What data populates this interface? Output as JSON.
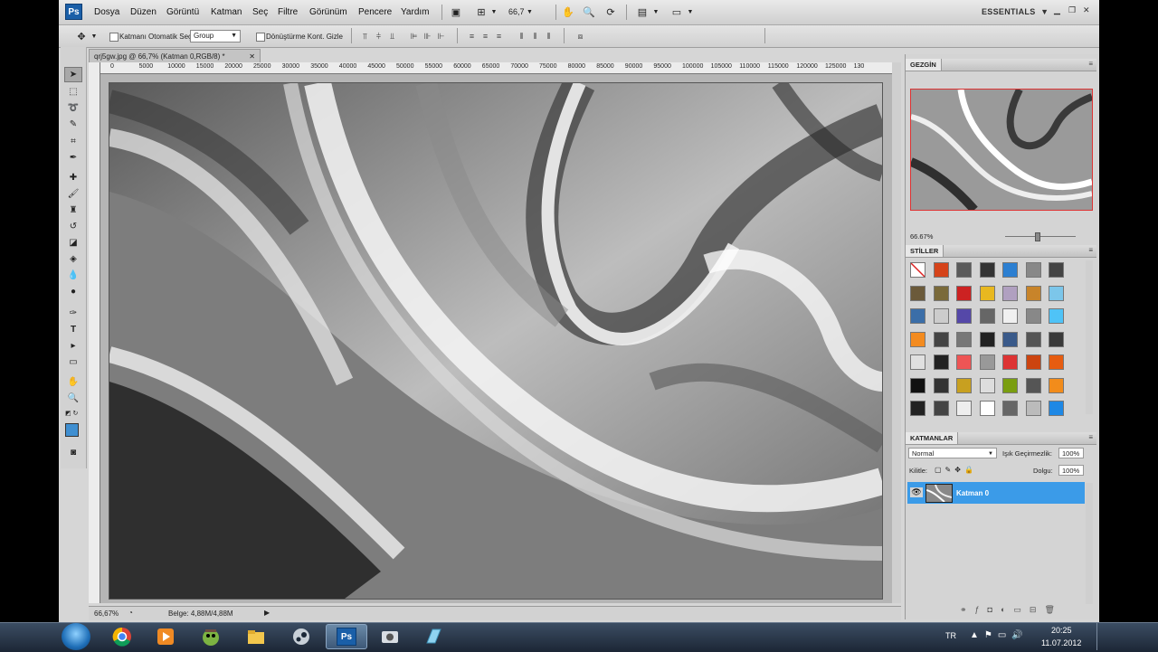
{
  "app": {
    "logo": "Ps",
    "workspace": "ESSENTIALS"
  },
  "menu": [
    "Dosya",
    "Düzen",
    "Görüntü",
    "Katman",
    "Seç",
    "Filtre",
    "Görünüm",
    "Pencere",
    "Yardım"
  ],
  "toolbar": {
    "zoom": "66,7"
  },
  "options": {
    "auto_select_label": "Katmanı Otomatik Seç:",
    "auto_select_value": "Group",
    "transform_label": "Dönüştürme Kont. Gizle"
  },
  "document": {
    "tab_title": "qrj5gw.jpg @ 66,7% (Katman 0,RGB/8) *",
    "ruler_ticks": [
      "0",
      "5000",
      "10000",
      "15000",
      "20000",
      "25000",
      "30000",
      "35000",
      "40000",
      "45000",
      "50000",
      "55000",
      "60000",
      "65000",
      "70000",
      "75000",
      "80000",
      "85000",
      "90000",
      "95000",
      "100000",
      "105000",
      "110000",
      "115000",
      "120000",
      "125000",
      "130"
    ],
    "zoom_status": "66,67%",
    "file_info": "Belge: 4,88M/4,88M"
  },
  "navigator": {
    "tab": "GEZGİN",
    "zoom": "66.67%"
  },
  "styles": {
    "tab": "STİLLER"
  },
  "layers": {
    "tab": "KATMANLAR",
    "blend_mode": "Normal",
    "opacity_label": "Işık Geçirmezlik:",
    "opacity_value": "100%",
    "lock_label": "Kilitle:",
    "fill_label": "Dolgu:",
    "fill_value": "100%",
    "layer_name": "Katman 0"
  },
  "taskbar": {
    "lang": "TR",
    "time": "20:25",
    "date": "11.07.2012"
  },
  "colors": {
    "foreground": "#3f8fd1",
    "selected_layer": "#3b9be8"
  }
}
